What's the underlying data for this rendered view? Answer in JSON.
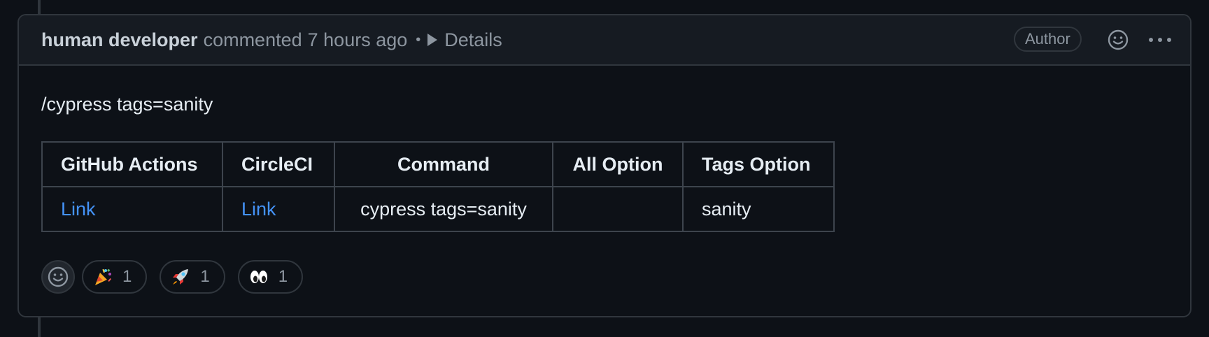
{
  "comment": {
    "author": "human developer",
    "action": "commented",
    "time": "7 hours ago",
    "separator": "•",
    "details_label": "Details",
    "badge": "Author",
    "body": "/cypress tags=sanity"
  },
  "table": {
    "headers": [
      "GitHub Actions",
      "CircleCI",
      "Command",
      "All Option",
      "Tags Option"
    ],
    "row": {
      "github_actions": "Link",
      "circleci": "Link",
      "command": "cypress tags=sanity",
      "all_option": "",
      "tags_option": "sanity"
    }
  },
  "reactions": [
    {
      "icon": "party-popper-icon",
      "count": "1"
    },
    {
      "icon": "rocket-icon",
      "count": "1"
    },
    {
      "icon": "eyes-icon",
      "count": "1"
    }
  ],
  "colors": {
    "background": "#0d1117",
    "header_background": "#161b22",
    "border": "#30363d",
    "link": "#4493f8",
    "muted_text": "#8d96a0"
  }
}
